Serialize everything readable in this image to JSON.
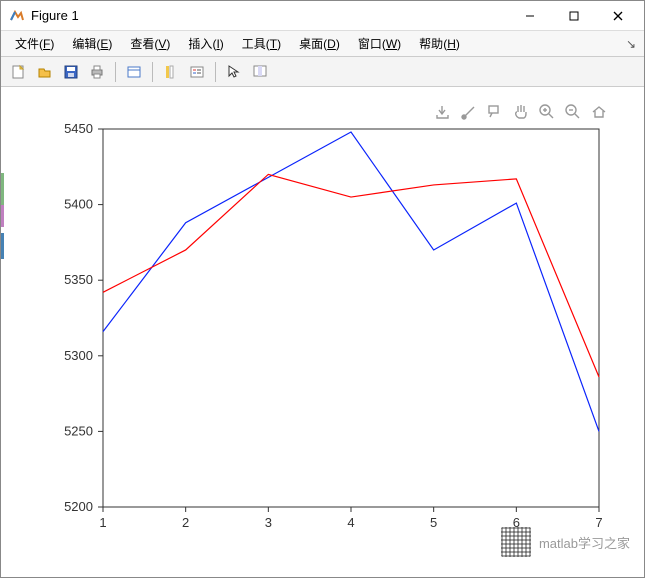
{
  "window": {
    "title": "Figure 1",
    "minimize": "—",
    "maximize": "□",
    "close": "×"
  },
  "menu": {
    "items": [
      {
        "label": "文件",
        "key": "F"
      },
      {
        "label": "编辑",
        "key": "E"
      },
      {
        "label": "查看",
        "key": "V"
      },
      {
        "label": "插入",
        "key": "I"
      },
      {
        "label": "工具",
        "key": "T"
      },
      {
        "label": "桌面",
        "key": "D"
      },
      {
        "label": "窗口",
        "key": "W"
      },
      {
        "label": "帮助",
        "key": "H"
      }
    ]
  },
  "toolbar": {
    "new": "新建",
    "open": "打开",
    "save": "保存",
    "print": "打印",
    "link": "链接",
    "colorbar": "颜色栏",
    "legend": "图例",
    "arrow": "编辑绘图",
    "datatips": "数据提示"
  },
  "plot_toolbar": {
    "brush": "刷",
    "export": "导出",
    "datatip": "数据提示",
    "pan": "平移",
    "zoomin": "放大",
    "zoomout": "缩小",
    "home": "还原视图"
  },
  "watermark": "matlab学习之家",
  "chart_data": {
    "type": "line",
    "x": [
      1,
      2,
      3,
      4,
      5,
      6,
      7
    ],
    "series": [
      {
        "name": "series_blue",
        "color": "#0b24fb",
        "values": [
          5316,
          5388,
          5418,
          5448,
          5370,
          5401,
          5250
        ]
      },
      {
        "name": "series_red",
        "color": "#ff0000",
        "values": [
          5342,
          5370,
          5420,
          5405,
          5413,
          5417,
          5286
        ]
      }
    ],
    "xlim": [
      1,
      7
    ],
    "ylim": [
      5200,
      5450
    ],
    "xticks": [
      1,
      2,
      3,
      4,
      5,
      6,
      7
    ],
    "yticks": [
      5200,
      5250,
      5300,
      5350,
      5400,
      5450
    ],
    "xlabel": "",
    "ylabel": "",
    "title": "",
    "grid": false
  }
}
